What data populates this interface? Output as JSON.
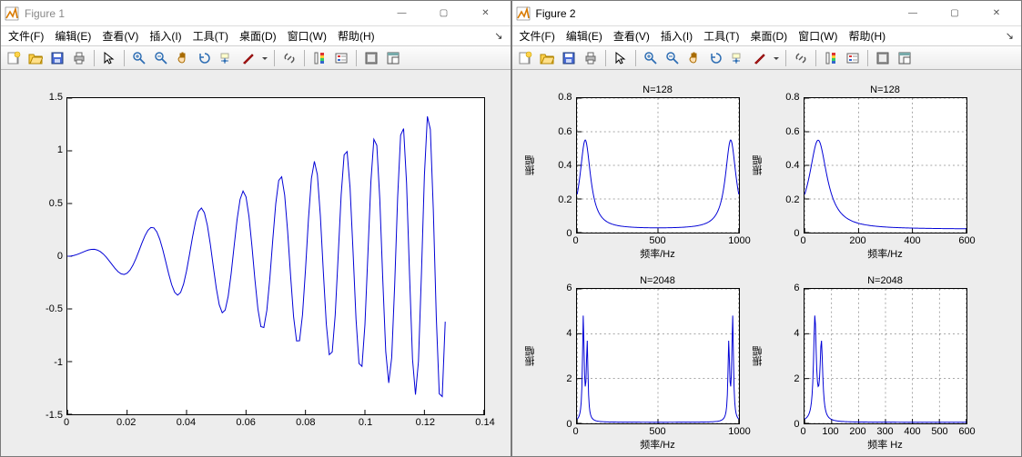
{
  "windows": [
    {
      "title": "Figure 1"
    },
    {
      "title": "Figure 2"
    }
  ],
  "menu_items": [
    "文件(F)",
    "编辑(E)",
    "查看(V)",
    "插入(I)",
    "工具(T)",
    "桌面(D)",
    "窗口(W)",
    "帮助(H)"
  ],
  "menu_tail_glyph": "↘",
  "win_btn_glyphs": {
    "min": "—",
    "max": "▢",
    "close": "✕"
  },
  "toolbar_icons": [
    "new-figure",
    "open",
    "save",
    "print",
    "|",
    "pointer",
    "|",
    "zoom-in",
    "zoom-out",
    "pan",
    "rotate",
    "data-cursor",
    "brush",
    "dropdown",
    "|",
    "link",
    "|",
    "colorbar",
    "legend",
    "|",
    "hide-tools",
    "dock"
  ],
  "chart_data": {
    "figure1": {
      "type": "line",
      "xlabel": "",
      "ylabel": "",
      "xlim": [
        0,
        0.14
      ],
      "ylim": [
        -1.5,
        1.5
      ],
      "xticks": [
        0,
        0.02,
        0.04,
        0.06,
        0.08,
        0.1,
        0.12,
        0.14
      ],
      "yticks": [
        -1.5,
        -1,
        -0.5,
        0,
        0.5,
        1,
        1.5
      ],
      "note": "time-domain growing oscillation (chirp-like), 128 samples over ~0.128s",
      "n_samples": 128
    },
    "figure2": {
      "subplots": [
        {
          "type": "line",
          "title": "N=128",
          "xlabel": "频率/Hz",
          "ylabel": "振幅",
          "xlim": [
            0,
            1000
          ],
          "ylim": [
            0,
            0.8
          ],
          "xticks": [
            0,
            500,
            1000
          ],
          "yticks": [
            0,
            0.2,
            0.4,
            0.6,
            0.8
          ],
          "peaks": [
            {
              "f": 50,
              "a": 0.53,
              "w": 40
            },
            {
              "f": 950,
              "a": 0.53,
              "w": 40
            }
          ],
          "baseline": 0.02
        },
        {
          "type": "line",
          "title": "N=128",
          "xlabel": "频率/Hz",
          "ylabel": "振幅",
          "xlim": [
            0,
            600
          ],
          "ylim": [
            0,
            0.8
          ],
          "xticks": [
            0,
            200,
            400,
            600
          ],
          "yticks": [
            0,
            0.2,
            0.4,
            0.6,
            0.8
          ],
          "peaks": [
            {
              "f": 50,
              "a": 0.53,
              "w": 40
            }
          ],
          "baseline": 0.02
        },
        {
          "type": "line",
          "title": "N=2048",
          "xlabel": "频率/Hz",
          "ylabel": "振幅",
          "xlim": [
            0,
            1000
          ],
          "ylim": [
            0,
            6
          ],
          "xticks": [
            0,
            500,
            1000
          ],
          "yticks": [
            0,
            2,
            4,
            6
          ],
          "peaks": [
            {
              "f": 38,
              "a": 4.6,
              "w": 6
            },
            {
              "f": 62,
              "a": 3.4,
              "w": 6
            },
            {
              "f": 938,
              "a": 3.4,
              "w": 6
            },
            {
              "f": 962,
              "a": 4.6,
              "w": 6
            }
          ],
          "baseline": 0.05
        },
        {
          "type": "line",
          "title": "N=2048",
          "xlabel": "频率 Hz",
          "ylabel": "振幅",
          "xlim": [
            0,
            600
          ],
          "ylim": [
            0,
            6
          ],
          "xticks": [
            0,
            100,
            200,
            300,
            400,
            500,
            600
          ],
          "yticks": [
            0,
            2,
            4,
            6
          ],
          "peaks": [
            {
              "f": 38,
              "a": 4.6,
              "w": 6
            },
            {
              "f": 62,
              "a": 3.4,
              "w": 6
            }
          ],
          "baseline": 0.05
        }
      ]
    }
  }
}
